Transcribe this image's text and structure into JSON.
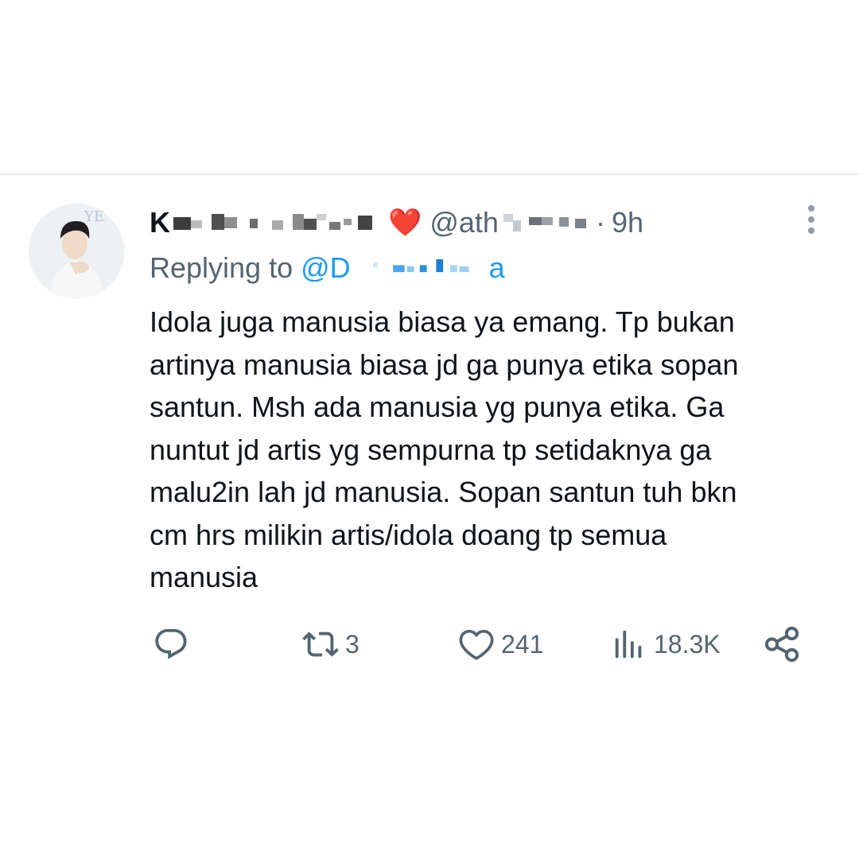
{
  "tweet": {
    "author": {
      "name_initial": "K",
      "emoji": "❤️",
      "handle_prefix": "@ath",
      "avatar_icon": "avatar-photo-icon"
    },
    "separator": "·",
    "time": "9h",
    "reply": {
      "prefix": "Replying to",
      "mention_start": "@D",
      "mention_end": "a"
    },
    "text_lines": [
      "Idola juga manusia biasa ya emang. Tp bukan",
      "artinya manusia biasa jd ga punya etika sopan",
      "santun. Msh ada manusia yg punya etika. Ga",
      "nuntut jd artis yg sempurna tp setidaknya ga",
      "malu2in lah jd manusia. Sopan santun tuh bkn",
      "cm hrs milikin artis/idola doang tp semua",
      "manusia"
    ],
    "actions": {
      "reply": {
        "icon": "reply-icon",
        "count": ""
      },
      "retweet": {
        "icon": "retweet-icon",
        "count": "3"
      },
      "like": {
        "icon": "heart-icon",
        "count": "241"
      },
      "views": {
        "icon": "views-icon",
        "count": "18.3K"
      },
      "share": {
        "icon": "share-icon"
      }
    },
    "more_menu_icon": "more-vertical-icon"
  },
  "colors": {
    "text_primary": "#0f1419",
    "text_secondary": "#536471",
    "link": "#1d9bf0",
    "divider": "#e6e8ea"
  }
}
